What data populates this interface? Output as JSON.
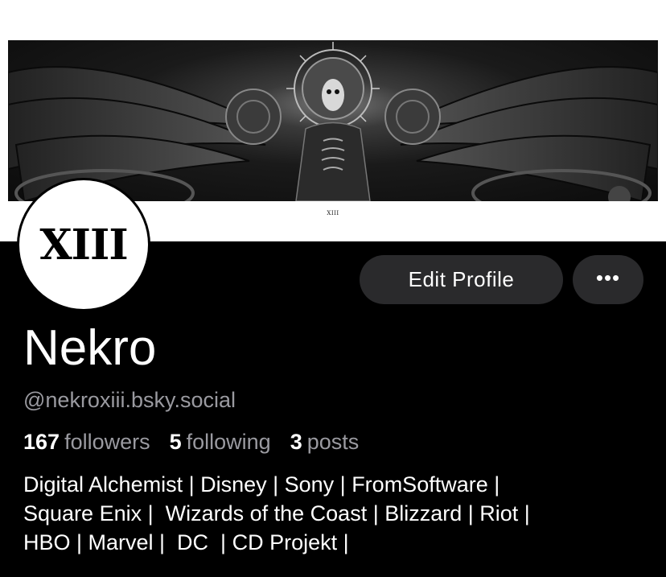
{
  "banner": {
    "caption": "XIII"
  },
  "avatar": {
    "text": "XIII"
  },
  "actions": {
    "edit_label": "Edit Profile",
    "more_label": "•••"
  },
  "profile": {
    "name": "Nekro",
    "handle": "@nekroxiii.bsky.social"
  },
  "stats": [
    {
      "count": "167",
      "label": "followers"
    },
    {
      "count": "5",
      "label": "following"
    },
    {
      "count": "3",
      "label": "posts"
    }
  ],
  "bio": {
    "lines": [
      "Digital Alchemist | Disney | Sony | FromSoftware |",
      "Square Enix |  Wizards of the Coast | Blizzard | Riot |",
      "HBO | Marvel |  DC  | CD Projekt |"
    ]
  },
  "colors": {
    "background": "#000000",
    "button": "#2a2a2c",
    "muted_text": "#9a9aa0"
  }
}
